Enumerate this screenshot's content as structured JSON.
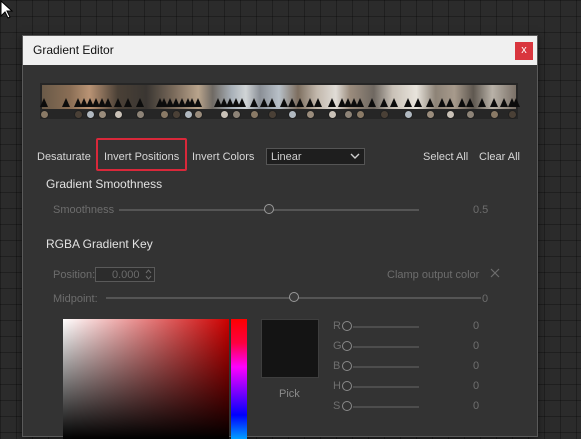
{
  "window": {
    "title": "Gradient Editor",
    "close_label": "x"
  },
  "toolbar": {
    "desaturate": "Desaturate",
    "invert_positions": "Invert Positions",
    "invert_colors": "Invert Colors",
    "interpolation": {
      "selected": "Linear"
    },
    "select_all": "Select All",
    "clear_all": "Clear All"
  },
  "smoothing": {
    "title": "Gradient Smoothness",
    "label": "Smoothness",
    "value": "0.5",
    "level": 0.5
  },
  "key": {
    "title": "RGBA Gradient Key",
    "position_label": "Position:",
    "position_value": "0.000",
    "clamp_label": "Clamp output color",
    "midpoint_label": "Midpoint:",
    "midpoint_value": "0",
    "midpoint_level": 0.5
  },
  "channels": [
    {
      "name": "R",
      "value": "0"
    },
    {
      "name": "G",
      "value": "0"
    },
    {
      "name": "B",
      "value": "0"
    },
    {
      "name": "H",
      "value": "0"
    },
    {
      "name": "S",
      "value": "0"
    }
  ],
  "pick_label": "Pick",
  "colors": {
    "highlight": "#d9283a",
    "close_button": "#d9363e",
    "swatch": "#141414"
  }
}
